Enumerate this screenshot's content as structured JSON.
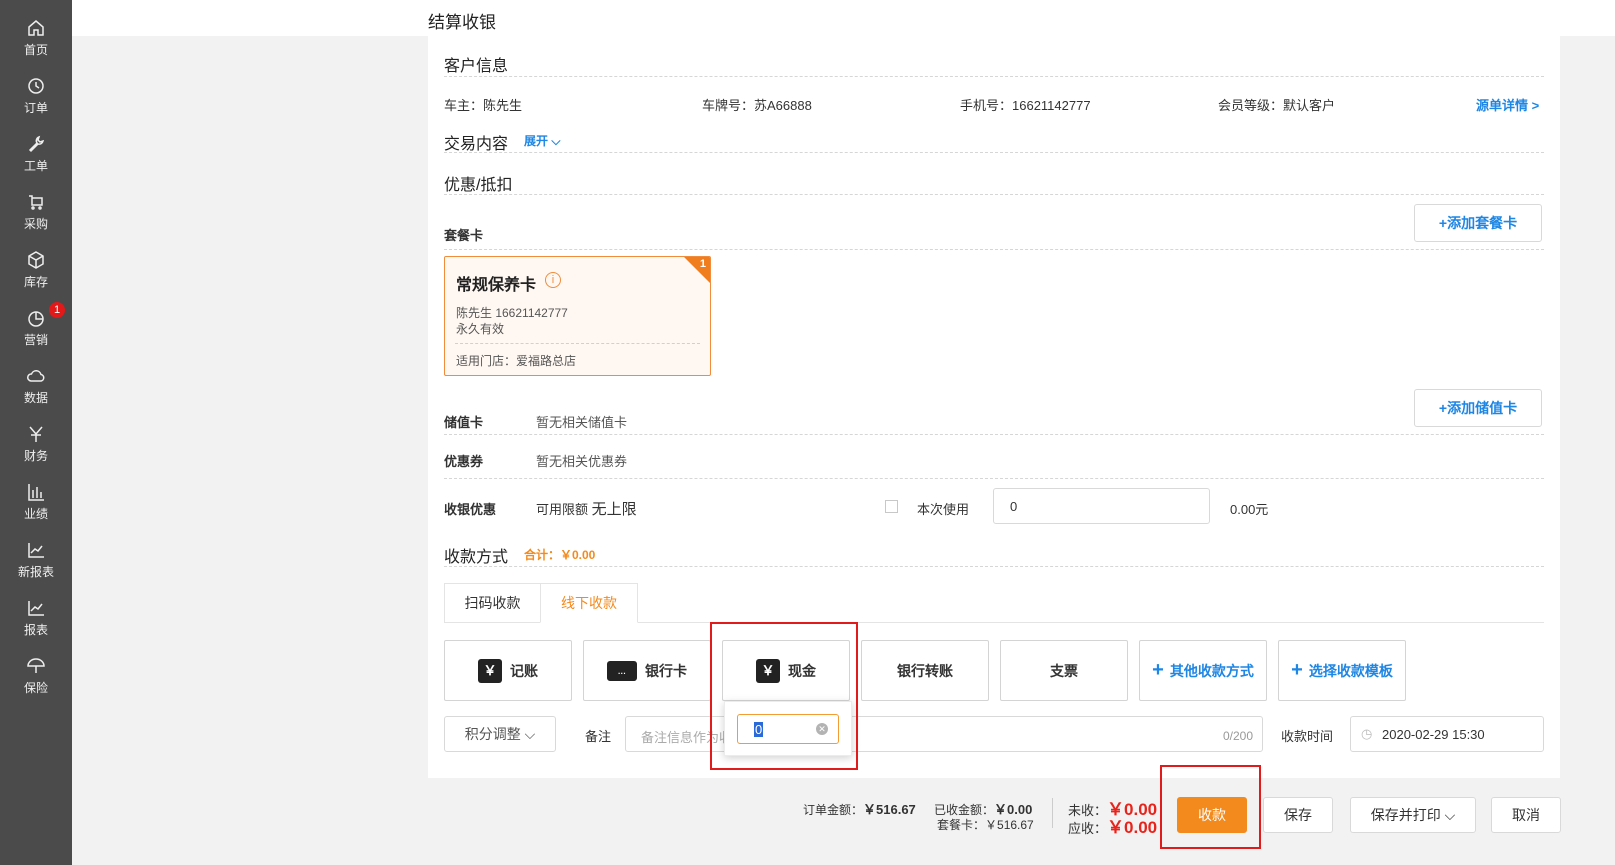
{
  "sidebar": {
    "items": [
      {
        "label": "首页",
        "icon": "home-icon"
      },
      {
        "label": "订单",
        "icon": "clock-icon"
      },
      {
        "label": "工单",
        "icon": "wrench-icon"
      },
      {
        "label": "采购",
        "icon": "cart-icon"
      },
      {
        "label": "库存",
        "icon": "box-icon"
      },
      {
        "label": "营销",
        "icon": "pie-icon",
        "badge": "1"
      },
      {
        "label": "数据",
        "icon": "cloud-icon"
      },
      {
        "label": "财务",
        "icon": "yen-icon"
      },
      {
        "label": "业绩",
        "icon": "bar-chart-icon"
      },
      {
        "label": "新报表",
        "icon": "line-chart-icon"
      },
      {
        "label": "报表",
        "icon": "line-chart-icon"
      },
      {
        "label": "保险",
        "icon": "umbrella-icon"
      }
    ]
  },
  "page": {
    "title": "结算收银"
  },
  "customer": {
    "section_title": "客户信息",
    "owner": "车主：陈先生",
    "plate": "车牌号：苏A66888",
    "phone": "手机号：16621142777",
    "level": "会员等级：默认客户",
    "detail_link": "源单详情 >"
  },
  "transaction": {
    "section_title": "交易内容",
    "expand": "展开"
  },
  "discount": {
    "section_title": "优惠/抵扣",
    "package_label": "套餐卡",
    "add_package": "添加套餐卡",
    "card": {
      "name": "常规保养卡",
      "badge": "1",
      "holder": "陈先生  16621142777",
      "validity": "永久有效",
      "store": "适用门店：爱福路总店"
    },
    "stored_label": "储值卡",
    "stored_value": "暂无相关储值卡",
    "add_stored": "添加储值卡",
    "coupon_label": "优惠券",
    "coupon_value": "暂无相关优惠券",
    "cashier_label": "收银优惠",
    "limit_prefix": "可用限额",
    "limit_value": "无上限",
    "use_label": "本次使用",
    "use_input": "0",
    "use_amount": "0.00元"
  },
  "payment": {
    "section_title": "收款方式",
    "total": "合计：￥0.00",
    "tabs": [
      "扫码收款",
      "线下收款"
    ],
    "methods": [
      {
        "label": "记账",
        "icon": "￥"
      },
      {
        "label": "银行卡",
        "icon": "card"
      },
      {
        "label": "现金",
        "icon": "￥"
      },
      {
        "label": "银行转账"
      },
      {
        "label": "支票"
      },
      {
        "label": "其他收款方式"
      },
      {
        "label": "选择收款模板"
      }
    ],
    "cash_input": "0",
    "points_adjust": "积分调整",
    "remark_label": "备注",
    "remark_placeholder": "备注信息作为收款记录",
    "remark_count": "0/200",
    "time_label": "收款时间",
    "time_value": "2020-02-29 15:30"
  },
  "footer": {
    "order_amount_label": "订单金额：",
    "order_amount": "￥516.67",
    "received_label": "已收金额：",
    "received": "￥0.00",
    "package_label": "套餐卡：",
    "package": "￥516.67",
    "unpaid_label": "未收：",
    "unpaid": "￥0.00",
    "due_label": "应收：",
    "due": "￥0.00",
    "collect_button": "收款",
    "save_button": "保存",
    "save_print_button": "保存并打印",
    "cancel_button": "取消"
  },
  "colors": {
    "accent": "#f38a1d",
    "link": "#1e86e4",
    "highlight": "#e01b1b"
  }
}
